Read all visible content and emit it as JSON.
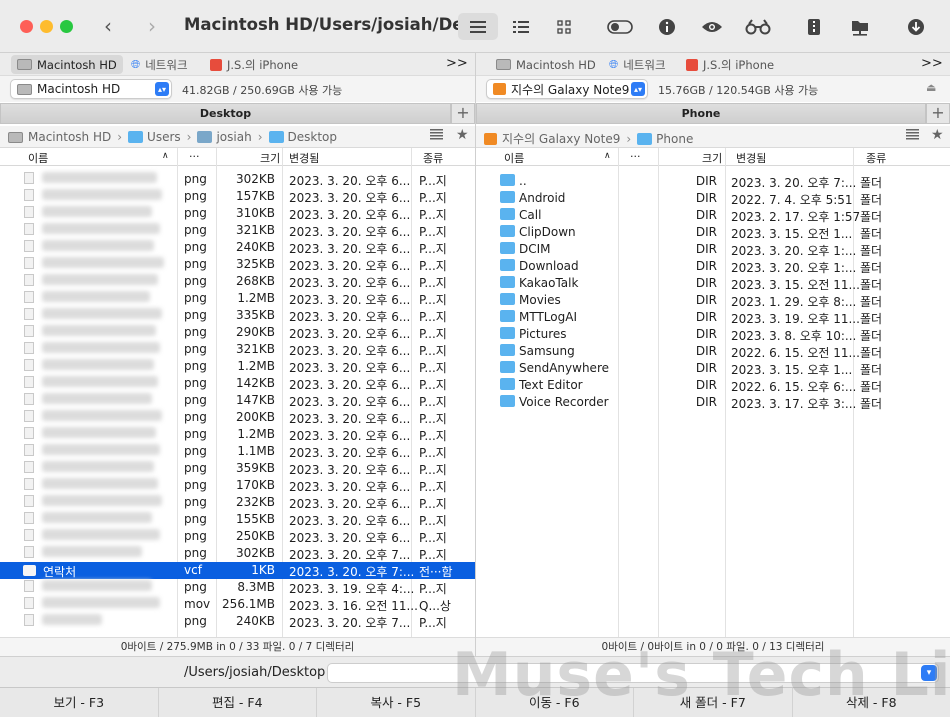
{
  "window": {
    "title": "Macintosh HD/Users/josiah/Des..."
  },
  "left": {
    "tabs": [
      "Macintosh HD",
      "네트워크",
      "J.S.의 iPhone"
    ],
    "more": ">>",
    "volume": {
      "name": "Macintosh HD",
      "info": "41.82GB / 250.69GB 사용 가능"
    },
    "panel_title": "Desktop",
    "breadcrumb": [
      "Macintosh HD",
      "Users",
      "josiah",
      "Desktop"
    ],
    "columns": {
      "name": "이름",
      "ext": "···",
      "size": "크기",
      "modified": "변경됨",
      "kind": "종류"
    },
    "rows": [
      {
        "ext": "png",
        "size": "302KB",
        "date": "2023. 3. 20. 오후 6...",
        "kind": "P...지"
      },
      {
        "ext": "png",
        "size": "157KB",
        "date": "2023. 3. 20. 오후 6...",
        "kind": "P...지"
      },
      {
        "ext": "png",
        "size": "310KB",
        "date": "2023. 3. 20. 오후 6...",
        "kind": "P...지"
      },
      {
        "ext": "png",
        "size": "321KB",
        "date": "2023. 3. 20. 오후 6...",
        "kind": "P...지"
      },
      {
        "ext": "png",
        "size": "240KB",
        "date": "2023. 3. 20. 오후 6...",
        "kind": "P...지"
      },
      {
        "ext": "png",
        "size": "325KB",
        "date": "2023. 3. 20. 오후 6...",
        "kind": "P...지"
      },
      {
        "ext": "png",
        "size": "268KB",
        "date": "2023. 3. 20. 오후 6...",
        "kind": "P...지"
      },
      {
        "ext": "png",
        "size": "1.2MB",
        "date": "2023. 3. 20. 오후 6...",
        "kind": "P...지"
      },
      {
        "ext": "png",
        "size": "335KB",
        "date": "2023. 3. 20. 오후 6...",
        "kind": "P...지"
      },
      {
        "ext": "png",
        "size": "290KB",
        "date": "2023. 3. 20. 오후 6...",
        "kind": "P...지"
      },
      {
        "ext": "png",
        "size": "321KB",
        "date": "2023. 3. 20. 오후 6...",
        "kind": "P...지"
      },
      {
        "ext": "png",
        "size": "1.2MB",
        "date": "2023. 3. 20. 오후 6...",
        "kind": "P...지"
      },
      {
        "ext": "png",
        "size": "142KB",
        "date": "2023. 3. 20. 오후 6...",
        "kind": "P...지"
      },
      {
        "ext": "png",
        "size": "147KB",
        "date": "2023. 3. 20. 오후 6...",
        "kind": "P...지"
      },
      {
        "ext": "png",
        "size": "200KB",
        "date": "2023. 3. 20. 오후 6...",
        "kind": "P...지"
      },
      {
        "ext": "png",
        "size": "1.2MB",
        "date": "2023. 3. 20. 오후 6...",
        "kind": "P...지"
      },
      {
        "ext": "png",
        "size": "1.1MB",
        "date": "2023. 3. 20. 오후 6...",
        "kind": "P...지"
      },
      {
        "ext": "png",
        "size": "359KB",
        "date": "2023. 3. 20. 오후 6...",
        "kind": "P...지"
      },
      {
        "ext": "png",
        "size": "170KB",
        "date": "2023. 3. 20. 오후 6...",
        "kind": "P...지"
      },
      {
        "ext": "png",
        "size": "232KB",
        "date": "2023. 3. 20. 오후 6...",
        "kind": "P...지"
      },
      {
        "ext": "png",
        "size": "155KB",
        "date": "2023. 3. 20. 오후 6...",
        "kind": "P...지"
      },
      {
        "ext": "png",
        "size": "250KB",
        "date": "2023. 3. 20. 오후 6...",
        "kind": "P...지"
      },
      {
        "ext": "png",
        "size": "302KB",
        "date": "2023. 3. 20. 오후 7...",
        "kind": "P...지"
      },
      {
        "name": "연락처",
        "ext": "vcf",
        "size": "1KB",
        "date": "2023. 3. 20. 오후 7:...",
        "kind": "전···함",
        "selected": true
      },
      {
        "ext": "png",
        "size": "8.3MB",
        "date": "2023. 3. 19. 오후 4:...",
        "kind": "P...지"
      },
      {
        "ext": "mov",
        "size": "256.1MB",
        "date": "2023. 3. 16. 오전 11...",
        "kind": "Q...상"
      },
      {
        "ext": "png",
        "size": "240KB",
        "date": "2023. 3. 20. 오후 7...",
        "kind": "P...지"
      }
    ],
    "status": "0바이트 / 275.9MB in 0 / 33 파일. 0 / 7 디렉터리"
  },
  "right": {
    "tabs": [
      "Macintosh HD",
      "네트워크",
      "J.S.의 iPhone"
    ],
    "more": ">>",
    "volume": {
      "name": "지수의 Galaxy Note9",
      "info": "15.76GB / 120.54GB 사용 가능"
    },
    "panel_title": "Phone",
    "breadcrumb": [
      "지수의 Galaxy Note9",
      "Phone"
    ],
    "columns": {
      "name": "이름",
      "ext": "···",
      "size": "크기",
      "modified": "변경됨",
      "kind": "종류"
    },
    "rows": [
      {
        "name": "..",
        "size": "DIR",
        "date": "2023. 3. 20. 오후 7:...",
        "kind": "폴더"
      },
      {
        "name": "Android",
        "size": "DIR",
        "date": "2022. 7. 4. 오후 5:51",
        "kind": "폴더"
      },
      {
        "name": "Call",
        "size": "DIR",
        "date": "2023. 2. 17. 오후 1:57",
        "kind": "폴더"
      },
      {
        "name": "ClipDown",
        "size": "DIR",
        "date": "2023. 3. 15. 오전 1...",
        "kind": "폴더"
      },
      {
        "name": "DCIM",
        "size": "DIR",
        "date": "2023. 3. 20. 오후 1:...",
        "kind": "폴더"
      },
      {
        "name": "Download",
        "size": "DIR",
        "date": "2023. 3. 20. 오후 1:...",
        "kind": "폴더"
      },
      {
        "name": "KakaoTalk",
        "size": "DIR",
        "date": "2023. 3. 15. 오전 11...",
        "kind": "폴더"
      },
      {
        "name": "Movies",
        "size": "DIR",
        "date": "2023. 1. 29. 오후 8:...",
        "kind": "폴더"
      },
      {
        "name": "MTTLogAI",
        "size": "DIR",
        "date": "2023. 3. 19. 오후 11...",
        "kind": "폴더"
      },
      {
        "name": "Pictures",
        "size": "DIR",
        "date": "2023. 3. 8. 오후 10:...",
        "kind": "폴더"
      },
      {
        "name": "Samsung",
        "size": "DIR",
        "date": "2022. 6. 15. 오전 11...",
        "kind": "폴더"
      },
      {
        "name": "SendAnywhere",
        "size": "DIR",
        "date": "2023. 3. 15. 오후 1...",
        "kind": "폴더"
      },
      {
        "name": "Text Editor",
        "size": "DIR",
        "date": "2022. 6. 15. 오후 6:...",
        "kind": "폴더"
      },
      {
        "name": "Voice Recorder",
        "size": "DIR",
        "date": "2023. 3. 17. 오후 3:...",
        "kind": "폴더"
      }
    ],
    "status": "0바이트 / 0바이트 in 0 / 0 파일. 0 / 13 디렉터리"
  },
  "pathbar": {
    "path": "/Users/josiah/Desktop"
  },
  "fkeys": [
    "보기 - F3",
    "편집 - F4",
    "복사 - F5",
    "이동 - F6",
    "새 폴더 - F7",
    "삭제 - F8"
  ],
  "watermark": "Muse's Tech Live",
  "colors": {
    "selection": "#0a5fe0",
    "folder": "#5ab3ef",
    "accent": "#2d7cf6"
  }
}
